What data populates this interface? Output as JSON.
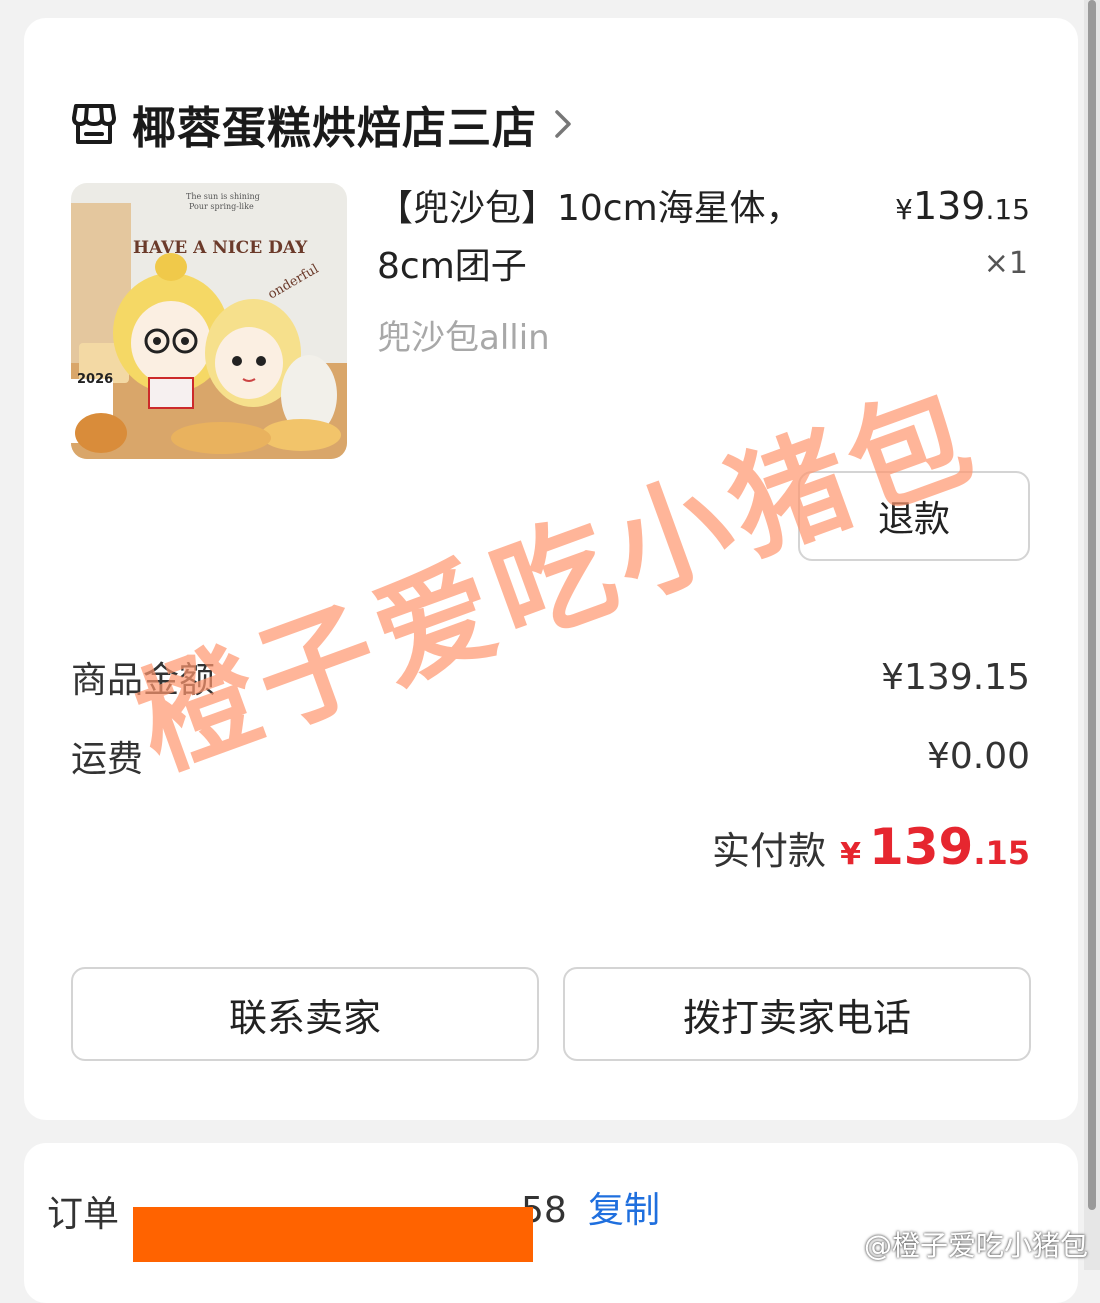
{
  "shop": {
    "name": "椰蓉蛋糕烘焙店三店",
    "icon": "store-icon"
  },
  "product": {
    "title": "【兜沙包】10cm海星体，8cm团子",
    "sku": "兜沙包allin",
    "price_currency": "¥",
    "price_int": "139",
    "price_dec": ".15",
    "quantity": "×1",
    "image_texts": {
      "line1": "The sun is shining",
      "line2": "Pour spring-like",
      "headline": "HAVE A NICE DAY",
      "curve": "onderful",
      "year": "2026"
    }
  },
  "actions": {
    "refund": "退款",
    "contact_seller": "联系卖家",
    "call_seller": "拨打卖家电话"
  },
  "summary": {
    "goods_label": "商品金额",
    "goods_value": "¥139.15",
    "shipping_label": "运费",
    "shipping_value": "¥0.00",
    "total_label": "实付款",
    "total_currency": "¥",
    "total_int": "139",
    "total_dec": ".15"
  },
  "order": {
    "label": "订单",
    "number_tail": "58",
    "copy": "复制"
  },
  "watermark": {
    "text": "橙子爱吃小猪包",
    "weibo": "@橙子爱吃小猪包"
  },
  "colors": {
    "accent_red": "#e6262f",
    "link_blue": "#1f6fde",
    "redaction_orange": "#ff6300",
    "watermark_orange": "#ff966e"
  }
}
